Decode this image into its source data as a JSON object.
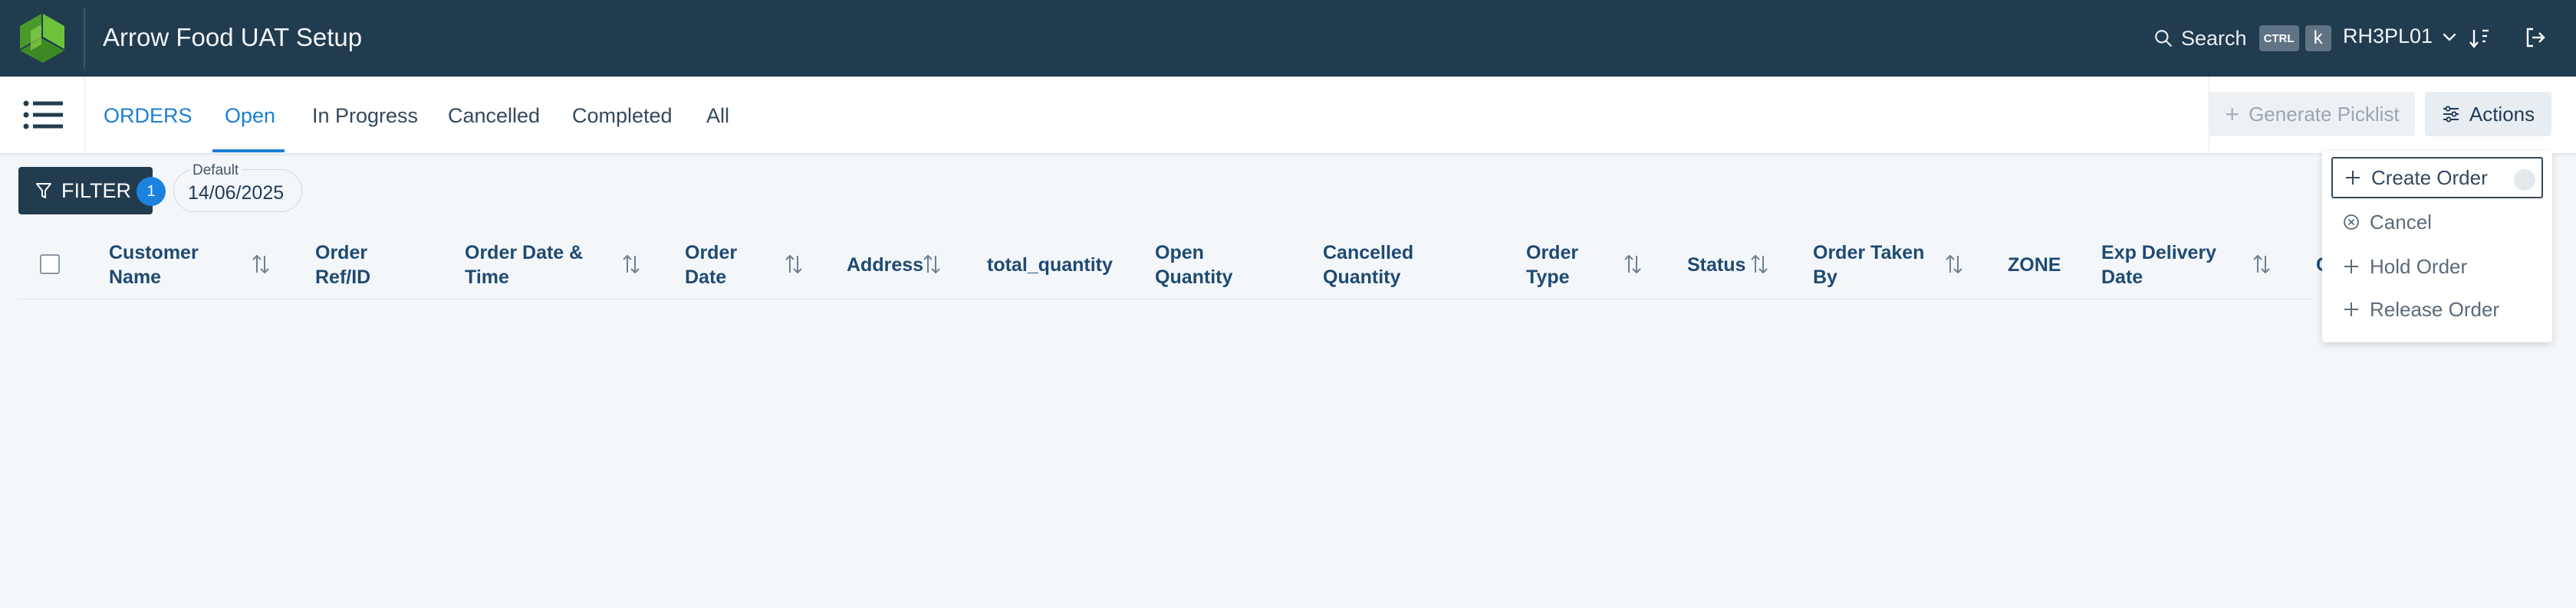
{
  "app": {
    "title": "Arrow Food UAT Setup"
  },
  "header": {
    "search_label": "Search",
    "shortcut_keys": [
      "CTRL",
      "k"
    ],
    "user_code": "RH3PL01"
  },
  "nav": {
    "section": "ORDERS",
    "tabs": [
      {
        "label": "Open",
        "active": true
      },
      {
        "label": "In Progress",
        "active": false
      },
      {
        "label": "Cancelled",
        "active": false
      },
      {
        "label": "Completed",
        "active": false
      },
      {
        "label": "All",
        "active": false
      }
    ]
  },
  "toolbar": {
    "generate_picklist": "Generate Picklist",
    "actions": "Actions"
  },
  "filter": {
    "label": "FILTER",
    "count": "1",
    "chip_label": "Default",
    "chip_value": "14/06/2025"
  },
  "table": {
    "columns": [
      {
        "label": "Customer Name",
        "sortable": true
      },
      {
        "label": "Order Ref/ID",
        "sortable": false
      },
      {
        "label": "Order Date & Time",
        "sortable": true
      },
      {
        "label": "Order Date",
        "sortable": true
      },
      {
        "label": "Address",
        "sortable": true
      },
      {
        "label": "total_quantity",
        "sortable": false
      },
      {
        "label": "Open Quantity",
        "sortable": false
      },
      {
        "label": "Cancelled Quantity",
        "sortable": false
      },
      {
        "label": "Order Type",
        "sortable": true
      },
      {
        "label": "Status",
        "sortable": true
      },
      {
        "label": "Order Taken By",
        "sortable": true
      },
      {
        "label": "ZONE",
        "sortable": false
      },
      {
        "label": "Exp Delivery Date",
        "sortable": true
      },
      {
        "label": "C",
        "sortable": false
      }
    ]
  },
  "actions_menu": {
    "items": [
      {
        "label": "Create Order",
        "icon": "plus-icon"
      },
      {
        "label": "Cancel",
        "icon": "circle-x-icon"
      },
      {
        "label": "Hold Order",
        "icon": "plus-icon"
      },
      {
        "label": "Release Order",
        "icon": "plus-icon"
      }
    ]
  },
  "colors": {
    "header_bg": "#213b4f",
    "accent": "#1b7fd6",
    "logo_green": "#5cb32e"
  }
}
